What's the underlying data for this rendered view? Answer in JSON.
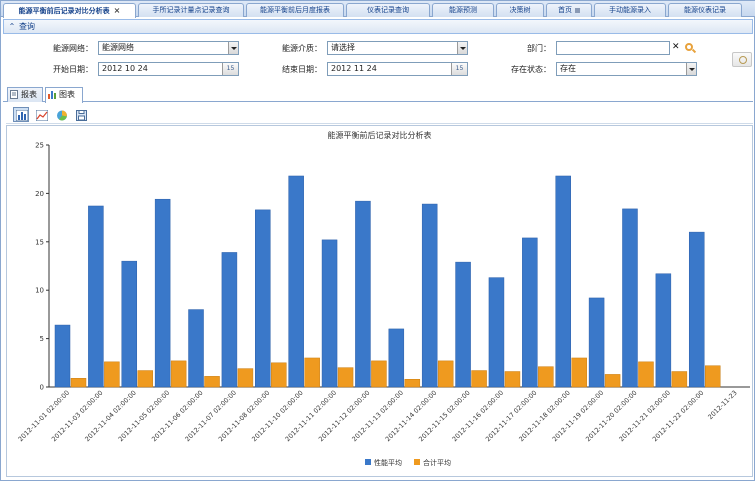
{
  "tabs": [
    {
      "label": "能源平衡前后记录对比分析表",
      "active": true,
      "closable": true
    },
    {
      "label": "手所记录计量点记录查询",
      "active": false
    },
    {
      "label": "能源平衡前后月度报表",
      "active": false
    },
    {
      "label": "仪表记录查询",
      "active": false
    },
    {
      "label": "能源预测",
      "active": false
    },
    {
      "label": "决策树",
      "active": false
    },
    {
      "label": "首页",
      "active": false,
      "locked": true
    },
    {
      "label": "手动能源录入",
      "active": false
    },
    {
      "label": "能源仪表记录",
      "active": false
    }
  ],
  "query": {
    "title": "查询",
    "network_label": "能源网络：",
    "network_value": "能源网络",
    "medium_label": "能源介质：",
    "medium_value": "请选择",
    "dept_label": "部门：",
    "dept_value": "",
    "start_label": "开始日期：",
    "start_value": "2012 10 24",
    "end_label": "结束日期：",
    "end_value": "2012 11 24",
    "status_label": "存在状态：",
    "status_value": "存在",
    "date_btn": "15"
  },
  "subtabs": [
    {
      "label": "报表",
      "active": false
    },
    {
      "label": "图表",
      "active": true
    }
  ],
  "toolbar": [
    "bar-chart-icon",
    "line-chart-icon",
    "pie-chart-icon",
    "save-icon"
  ],
  "colors": {
    "series1": "#3a78c9",
    "series2": "#ef9a1f",
    "accent": "#15428b"
  },
  "chart_data": {
    "type": "bar",
    "title": "能源平衡前后记录对比分析表",
    "ylim": [
      0,
      25
    ],
    "yticks": [
      0,
      5,
      10,
      15,
      20,
      25
    ],
    "categories": [
      "2012-11-01 02:00:00",
      "2012-11-03 02:00:00",
      "2012-11-04 02:00:00",
      "2012-11-05 02:00:00",
      "2012-11-06 02:00:00",
      "2012-11-07 02:00:00",
      "2012-11-08 02:00:00",
      "2012-11-10 02:00:00",
      "2012-11-11 02:00:00",
      "2012-11-12 02:00:00",
      "2012-11-13 02:00:00",
      "2012-11-14 02:00:00",
      "2012-11-15 02:00:00",
      "2012-11-16 02:00:00",
      "2012-11-17 02:00:00",
      "2012-11-18 02:00:00",
      "2012-11-19 02:00:00",
      "2012-11-20 02:00:00",
      "2012-11-21 02:00:00",
      "2012-11-22 02:00:00",
      "2012-11-23"
    ],
    "series": [
      {
        "name": "性能平均",
        "color": "#3a78c9",
        "values": [
          6.4,
          18.7,
          13.0,
          19.4,
          8.0,
          13.9,
          18.3,
          21.8,
          15.2,
          19.2,
          6.0,
          18.9,
          12.9,
          11.3,
          15.4,
          21.8,
          9.2,
          18.4,
          11.7,
          16.0,
          0
        ]
      },
      {
        "name": "合计平均",
        "color": "#ef9a1f",
        "values": [
          0.9,
          2.6,
          1.7,
          2.7,
          1.1,
          1.9,
          2.5,
          3.0,
          2.0,
          2.7,
          0.8,
          2.7,
          1.7,
          1.6,
          2.1,
          3.0,
          1.3,
          2.6,
          1.6,
          2.2,
          0
        ]
      }
    ],
    "legend_position": "bottom",
    "grid": false
  }
}
